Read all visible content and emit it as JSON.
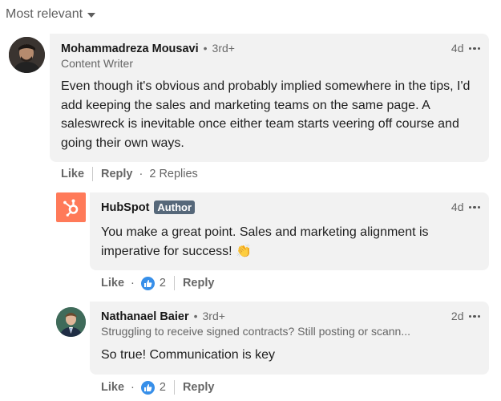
{
  "sort": {
    "label": "Most relevant",
    "icon": "caret-down-icon"
  },
  "comments": [
    {
      "author": "Mohammadreza Mousavi",
      "degree": "3rd+",
      "headline": "Content Writer",
      "time": "4d",
      "text": "Even though it's obvious and probably implied somewhere in the tips, I'd add keeping the sales and marketing teams on the same page. A saleswreck is inevitable once either team starts veering off course and going their own ways.",
      "actions": {
        "like": "Like",
        "reply": "Reply",
        "replies": "2 Replies"
      }
    }
  ],
  "replies": [
    {
      "author": "HubSpot",
      "badge": "Author",
      "time": "4d",
      "text": "You make a great point. Sales and marketing alignment is imperative for success! 👏",
      "actions": {
        "like": "Like",
        "reaction_count": "2",
        "reply": "Reply"
      },
      "logo_color": "#ff7a59"
    },
    {
      "author": "Nathanael Baier",
      "degree": "3rd+",
      "headline": "Struggling to receive signed contracts? Still posting or scann...",
      "time": "2d",
      "text": "So true! Communication is key",
      "actions": {
        "like": "Like",
        "reaction_count": "2",
        "reply": "Reply"
      }
    }
  ],
  "colors": {
    "bubble": "#f2f2f2",
    "like_blue": "#378fe9",
    "badge": "#56687a",
    "hubspot_orange": "#ff7a59"
  },
  "separators": {
    "dot": "•",
    "middot": "·"
  }
}
